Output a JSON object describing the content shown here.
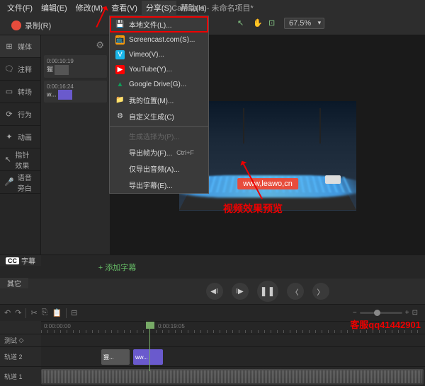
{
  "app_title": "Camtasia - 未命名项目*",
  "menubar": [
    "文件(F)",
    "编辑(E)",
    "修改(M)",
    "查看(V)",
    "分享(S)",
    "帮助(H)"
  ],
  "record_label": "录制(R)",
  "zoom_level": "67.5%",
  "side_tabs": [
    {
      "icon": "⊞",
      "label": "媒体"
    },
    {
      "icon": "🗨",
      "label": "注释"
    },
    {
      "icon": "▭",
      "label": "转场"
    },
    {
      "icon": "⟳",
      "label": "行为"
    },
    {
      "icon": "✦",
      "label": "动画"
    },
    {
      "icon": "↖",
      "label": "指针效果"
    },
    {
      "icon": "🎤",
      "label": "语音旁白"
    }
  ],
  "clips": [
    {
      "dur": "0:00:10:19",
      "name": "猩"
    },
    {
      "dur": "0:00:16:24",
      "name": "w..."
    }
  ],
  "share_menu": [
    {
      "icon": "💾",
      "label": "本地文件(L)...",
      "hl": true
    },
    {
      "icon": "📺",
      "label": "Screencast.com(S)...",
      "color": "#f90"
    },
    {
      "icon": "V",
      "label": "Vimeo(V)...",
      "color": "#1ab7ea"
    },
    {
      "icon": "▶",
      "label": "YouTube(Y)...",
      "color": "#f00"
    },
    {
      "icon": "▲",
      "label": "Google Drive(G)...",
      "color": "#0f9d58"
    },
    {
      "icon": "📁",
      "label": "我的位置(M)..."
    },
    {
      "icon": "⚙",
      "label": "自定义生成(C)"
    },
    {
      "sep": true
    },
    {
      "label": "生成选择为(P)...",
      "disabled": true
    },
    {
      "label": "导出帧为(F)...",
      "shortcut": "Ctrl+F"
    },
    {
      "label": "仅导出音频(A)..."
    },
    {
      "label": "导出字幕(E)..."
    }
  ],
  "watermark": "www,leawo,cn",
  "preview_annotation": "视频效果预览",
  "cc_label": "字幕",
  "other_label": "其它",
  "add_subtitle": "+ 添加字幕",
  "ruler_marks": {
    "t1": "0:00:00:00",
    "t2": "0:00:19:05"
  },
  "tracks": [
    {
      "name": "测试",
      "icon": "◇"
    },
    {
      "name": "轨道 2"
    },
    {
      "name": "轨道 1"
    }
  ],
  "track_clips": {
    "img": "猩...",
    "vid": "ww..."
  },
  "kefu": "客服qq41442901"
}
